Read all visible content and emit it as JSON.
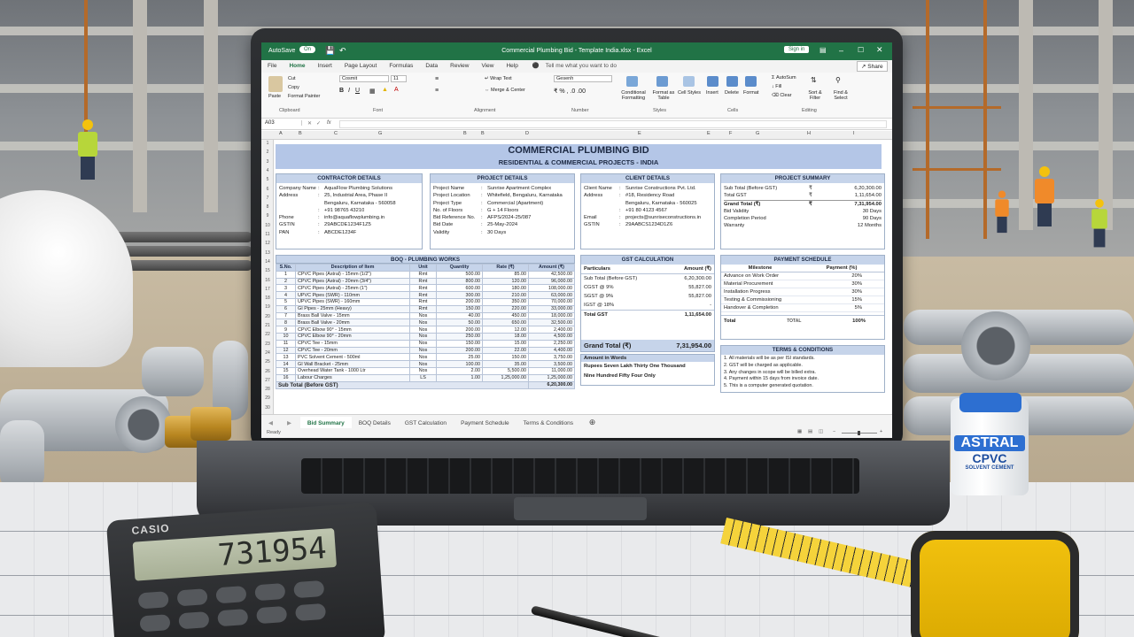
{
  "excel": {
    "autosave_label": "AutoSave",
    "autosave_state": "On",
    "window_title": "Commercial Plumbing Bid - Template India.xlsx - Excel",
    "sign_in": "Sign in",
    "share": "Share",
    "tell_me": "Tell me what you want to do",
    "ribbon_tabs": [
      "File",
      "Home",
      "Insert",
      "Page Layout",
      "Formulas",
      "Data",
      "Review",
      "View",
      "Help"
    ],
    "ribbon_groups": [
      "Clipboard",
      "Font",
      "Alignment",
      "Number",
      "Styles",
      "Cells",
      "Editing"
    ],
    "ribbon_labels": {
      "paste": "Paste",
      "cut": "Cut",
      "copy": "Copy",
      "format_painter": "Format Painter",
      "font_name": "Cosmit",
      "font_size": "11",
      "wrap_text": "Wrap Text",
      "merge_center": "Merge & Center",
      "number_format": "Gesenh",
      "conditional_formatting": "Conditional Formatting",
      "format_as_table": "Format as Table",
      "cell_styles": "Cell Styles",
      "insert": "Insert",
      "delete": "Delete",
      "format": "Format",
      "autosum": "AutoSum",
      "fill": "Fill",
      "clear": "Clear",
      "sort_filter": "Sort & Filter",
      "find_select": "Find & Select"
    },
    "name_box": "A03",
    "column_headers": [
      "A",
      "B",
      "C",
      "G",
      "B",
      "B",
      "D",
      "E",
      "E",
      "F",
      "G",
      "H",
      "I"
    ],
    "row_numbers": [
      "1",
      "2",
      "3",
      "4",
      "5",
      "6",
      "7",
      "8",
      "9",
      "10",
      "11",
      "12",
      "13",
      "14",
      "15",
      "16",
      "17",
      "18",
      "19",
      "20",
      "21",
      "22",
      "23",
      "24",
      "25",
      "26",
      "27",
      "28",
      "29",
      "30"
    ],
    "sheet_tabs": [
      "Bid Summary",
      "BOQ Details",
      "GST Calculation",
      "Payment Schedule",
      "Terms & Conditions"
    ],
    "status": "Ready"
  },
  "bid": {
    "title": "COMMERCIAL PLUMBING BID",
    "subtitle": "RESIDENTIAL & COMMERCIAL PROJECTS - INDIA",
    "contractor": {
      "header": "CONTRACTOR DETAILS",
      "rows": [
        {
          "k": "Company Name",
          "s": ":",
          "v": "AquaFlow Plumbing Solutions"
        },
        {
          "k": "Address",
          "s": ":",
          "v": "25, Industrial Area, Phase II"
        },
        {
          "k": "",
          "s": "",
          "v": "Bengaluru, Karnataka - 560058"
        },
        {
          "k": "",
          "s": ":",
          "v": "+91 98765 43210"
        },
        {
          "k": "Phone",
          "s": ":",
          "v": "info@aquaflowplumbing.in"
        },
        {
          "k": "GSTIN",
          "s": ":",
          "v": "29ABCDE1234F1Z5"
        },
        {
          "k": "PAN",
          "s": ":",
          "v": "ABCDE1234F"
        }
      ]
    },
    "project": {
      "header": "PROJECT DETAILS",
      "rows": [
        {
          "k": "Project Name",
          "s": ":",
          "v": "Sunrise Apartment Complex"
        },
        {
          "k": "Project Location",
          "s": ":",
          "v": "Whitefield, Bengaluru, Karnataka"
        },
        {
          "k": "Project Type",
          "s": ":",
          "v": "Commercial (Apartment)"
        },
        {
          "k": "No. of Floors",
          "s": ":",
          "v": "G + 14 Floors"
        },
        {
          "k": "Bid Reference No.",
          "s": ":",
          "v": "AFPS/2024-25/087"
        },
        {
          "k": "Bid Date",
          "s": ":",
          "v": "25-May-2024"
        },
        {
          "k": "Validity",
          "s": ":",
          "v": "30 Days"
        }
      ]
    },
    "client": {
      "header": "CLIENT DETAILS",
      "rows": [
        {
          "k": "Client Name",
          "s": ":",
          "v": "Sunrise Constructions Pvt. Ltd."
        },
        {
          "k": "Address",
          "s": ":",
          "v": "#18, Residency Road"
        },
        {
          "k": "",
          "s": "",
          "v": "Bengaluru, Karnataka - 560025"
        },
        {
          "k": "",
          "s": ":",
          "v": "+91 80 4123 4567"
        },
        {
          "k": "Email",
          "s": ":",
          "v": "projects@sunriseconstructions.in"
        },
        {
          "k": "GSTIN",
          "s": ":",
          "v": "29AABCS1234D1Z6"
        }
      ]
    },
    "summary": {
      "header": "PROJECT SUMMARY",
      "rows": [
        {
          "k": "Sub Total (Before GST)",
          "s": "₹",
          "v": "6,20,300.00"
        },
        {
          "k": "Total GST",
          "s": "₹",
          "v": "1,11,654.00"
        },
        {
          "k": "Grand Total (₹)",
          "s": "₹",
          "v": "7,31,954.00"
        },
        {
          "k": "Bid Validity",
          "s": "",
          "v": "30 Days"
        },
        {
          "k": "Completion Period",
          "s": "",
          "v": "90 Days"
        },
        {
          "k": "Warranty",
          "s": "",
          "v": "12 Months"
        }
      ]
    },
    "boq": {
      "header": "BOQ - PLUMBING WORKS",
      "columns": [
        "S.No.",
        "Description of Item",
        "Unit",
        "Quantity",
        "Rate (₹)",
        "Amount (₹)"
      ],
      "rows": [
        [
          "1",
          "CPVC Pipes (Astral) - 15mm (1/2\")",
          "Rmt",
          "500.00",
          "85.00",
          "42,500.00"
        ],
        [
          "2",
          "CPVC Pipes (Astral) - 20mm (3/4\")",
          "Rmt",
          "800.00",
          "120.00",
          "96,000.00"
        ],
        [
          "3",
          "CPVC Pipes (Astral) - 25mm (1\")",
          "Rmt",
          "600.00",
          "180.00",
          "108,000.00"
        ],
        [
          "4",
          "UPVC Pipes (SWR) - 110mm",
          "Rmt",
          "300.00",
          "210.00",
          "63,000.00"
        ],
        [
          "5",
          "UPVC Pipes (SWR) - 160mm",
          "Rmt",
          "200.00",
          "350.00",
          "70,000.00"
        ],
        [
          "6",
          "GI Pipes - 25mm (Heavy)",
          "Rmt",
          "150.00",
          "220.00",
          "33,000.00"
        ],
        [
          "7",
          "Brass Ball Valve - 15mm",
          "Nos",
          "40.00",
          "450.00",
          "18,000.00"
        ],
        [
          "8",
          "Brass Ball Valve - 20mm",
          "Nos",
          "50.00",
          "650.00",
          "32,500.00"
        ],
        [
          "9",
          "CPVC Elbow 90° - 15mm",
          "Nos",
          "200.00",
          "12.00",
          "2,400.00"
        ],
        [
          "10",
          "CPVC Elbow 90° - 20mm",
          "Nos",
          "250.00",
          "18.00",
          "4,500.00"
        ],
        [
          "11",
          "CPVC Tee - 15mm",
          "Nos",
          "150.00",
          "15.00",
          "2,250.00"
        ],
        [
          "12",
          "CPVC Tee - 20mm",
          "Nos",
          "200.00",
          "22.00",
          "4,400.00"
        ],
        [
          "13",
          "PVC Solvent Cement - 500ml",
          "Nos",
          "25.00",
          "150.00",
          "3,750.00"
        ],
        [
          "14",
          "GI Wall Bracket - 25mm",
          "Nos",
          "100.00",
          "35.00",
          "3,500.00"
        ],
        [
          "15",
          "Overhead Water Tank - 1000 Ltr",
          "Nos",
          "2.00",
          "5,500.00",
          "11,000.00"
        ],
        [
          "16",
          "Labour Charges",
          "LS",
          "1.00",
          "1,25,000.00",
          "1,25,000.00"
        ]
      ],
      "subtotal_label": "Sub Total (Before GST)",
      "subtotal_value": "6,20,300.00"
    },
    "gst": {
      "header": "GST CALCULATION",
      "col_particulars": "Particulars",
      "col_amount": "Amount (₹)",
      "rows": [
        {
          "k": "Sub Total (Before GST)",
          "v": "6,20,300.00"
        },
        {
          "k": "CGST @ 9%",
          "v": "55,827.00"
        },
        {
          "k": "SGST @ 9%",
          "v": "55,827.00"
        },
        {
          "k": "IGST @ 18%",
          "v": "-"
        },
        {
          "k": "Total GST",
          "v": "1,11,654.00"
        }
      ],
      "grand_label": "Grand Total (₹)",
      "grand_value": "7,31,954.00"
    },
    "words": {
      "header": "Amount in Words",
      "line1": "Rupees Seven Lakh Thirty One Thousand",
      "line2": "Nine Hundred Fifty Four Only"
    },
    "payment": {
      "header": "PAYMENT SCHEDULE",
      "col_milestone": "Milestone",
      "col_payment": "Payment (%)",
      "rows": [
        {
          "k": "Advance on Work Order",
          "v": "20%"
        },
        {
          "k": "Material Procurement",
          "v": "30%"
        },
        {
          "k": "Installation Progress",
          "v": "30%"
        },
        {
          "k": "Testing & Commissioning",
          "v": "15%"
        },
        {
          "k": "Handover & Completion",
          "v": "5%"
        }
      ],
      "total_label": "Total",
      "total_mid": "TOTAL",
      "total_value": "100%"
    },
    "terms": {
      "header": "TERMS & CONDITIONS",
      "items": [
        "1.  All materials will be as per ISI standards.",
        "2.  GST will be charged as applicable.",
        "3.  Any changes in scope will be billed extra.",
        "4.  Payment within 15 days from invoice date.",
        "5.  This is a computer generated quotation."
      ]
    }
  },
  "calculator": {
    "brand": "CASIO",
    "display": "731954"
  },
  "jar": {
    "brand": "ASTRAL",
    "product": "CPVC",
    "sub": "SOLVENT CEMENT"
  },
  "colors": {
    "excel_green": "#217346",
    "header_blue": "#c6d4ea",
    "title_blue": "#b4c6e7"
  }
}
